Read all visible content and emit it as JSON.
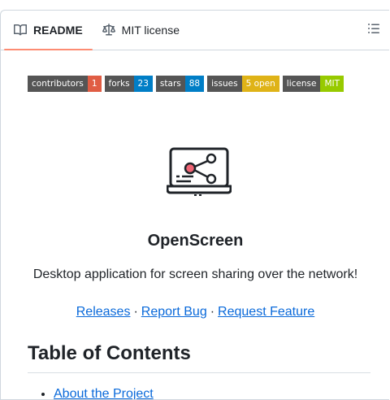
{
  "tabs": [
    {
      "label": "README",
      "icon": "book-icon",
      "active": true
    },
    {
      "label": "MIT license",
      "icon": "law-icon",
      "active": false
    }
  ],
  "toc_button_icon": "list-unordered-icon",
  "badges": [
    {
      "label": "contributors",
      "value": "1",
      "color": "#e05d44"
    },
    {
      "label": "forks",
      "value": "23",
      "color": "#007ec6"
    },
    {
      "label": "stars",
      "value": "88",
      "color": "#007ec6"
    },
    {
      "label": "issues",
      "value": "5 open",
      "color": "#dfb317"
    },
    {
      "label": "license",
      "value": "MIT",
      "color": "#97ca00"
    }
  ],
  "logo_icon": "screen-share-icon",
  "project": {
    "title": "OpenScreen",
    "tagline": "Desktop application for screen sharing over the network!"
  },
  "links": [
    {
      "label": "Releases"
    },
    {
      "label": "Report Bug"
    },
    {
      "label": "Request Feature"
    }
  ],
  "link_separator": "·",
  "toc": {
    "heading": "Table of Contents",
    "items": [
      "About the Project"
    ]
  },
  "colors": {
    "link": "#0969da",
    "active_tab_underline": "#fd8c73",
    "border": "#d0d7de"
  }
}
